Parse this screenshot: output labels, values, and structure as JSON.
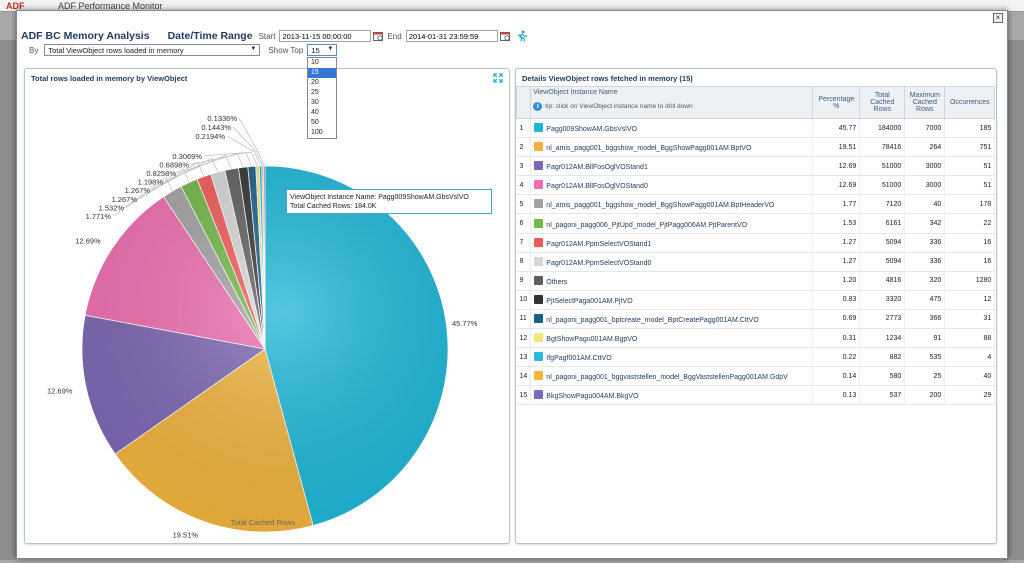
{
  "background_app": {
    "logo": "ADF",
    "title": "ADF Performance Monitor"
  },
  "header": {
    "app_title": "ADF BC Memory Analysis",
    "range_title": "Date/Time Range",
    "start_label": "Start",
    "start_value": "2013-11-15 00:00:00",
    "end_label": "End",
    "end_value": "2014-01-31 23:59:59",
    "by_label": "By",
    "by_value": "Total ViewObject rows loaded in memory",
    "show_top_label": "Show Top",
    "show_top_value": "15",
    "show_top_options": [
      "10",
      "15",
      "20",
      "25",
      "30",
      "40",
      "50",
      "100"
    ]
  },
  "left_panel": {
    "title": "Total rows loaded in memory by ViewObject",
    "tooltip_line1": "ViewObject Instance Name: Pagg009ShowAM.GbsVslVO",
    "tooltip_line2": "Total Cached Rows: 184.0K"
  },
  "chart_data": {
    "type": "pie",
    "title": "Total rows loaded in memory by ViewObject",
    "xlabel": "Total Cached Rows",
    "slice_labels": [
      "45.77%",
      "19.51%",
      "12.69%",
      "12.69%",
      "1.771%",
      "1.532%",
      "1.267%",
      "1.267%",
      "1.198%",
      "0.8258%",
      "0.6898%",
      "0.3069%",
      "0.2194%",
      "0.1443%",
      "0.1336%"
    ],
    "categories": [
      "Pagg009ShowAM.GbsVslVO",
      "nl_amis_pagg001_bggshow_model_BggShowPagg001AM.BptVO",
      "Pagr012AM.BllFosOglVOStand1",
      "Pagr012AM.BllFosOglVOStand0",
      "nl_amis_pagg001_bggshow_model_BggShowPagg001AM.BptHeaderVO",
      "nl_pagoni_pagg006_PjtUpd_model_PjtPagg006AM.PjtParentVO",
      "Pagr012AM.PpmSelectVOStand1",
      "Pagr012AM.PpmSelectVOStand0",
      "Others",
      "PjtSelectPaga001AM.PjtVO",
      "nl_pagoni_pagg001_bptcreate_model_BptCreatePagg001AM.CttVO",
      "BgtShowPagu001AM.BgpVO",
      "IfgPagf001AM.CttVO",
      "nl_pagoni_pagg001_bggvaststellen_model_BggVaststellenPagg001AM.GdpV",
      "BkgShowPagu004AM.BkgVO"
    ],
    "values": [
      45.77,
      19.51,
      12.69,
      12.69,
      1.771,
      1.532,
      1.267,
      1.267,
      1.198,
      0.8258,
      0.6898,
      0.3069,
      0.2194,
      0.1443,
      0.1336
    ],
    "colors": [
      "#1cb6d6",
      "#f0b23c",
      "#7c66b2",
      "#ee6fb0",
      "#a3a3a3",
      "#72b84a",
      "#f25a5a",
      "#d6d6d6",
      "#5f5f5f",
      "#333333",
      "#1a5f8c",
      "#f0e680",
      "#2bb8e0",
      "#f4b63c",
      "#7a6ab8"
    ]
  },
  "right_panel": {
    "title": "Details ViewObject rows fetched in memory (15)",
    "columns": {
      "name": "ViewObject Instance Name",
      "tip": "tip: click on ViewObject instance name to drill down",
      "percentage": "Percentage %",
      "total_cached": "Total Cached Rows",
      "max_cached": "Maximum Cached Rows",
      "occurrences": "Occurrences"
    },
    "rows": [
      {
        "idx": "1",
        "name": "Pagg009ShowAM.GbsVslVO",
        "color": "#1cb6d6",
        "pct": "45.77",
        "total": "184000",
        "max": "7000",
        "occ": "185"
      },
      {
        "idx": "2",
        "name": "nl_amis_pagg001_bggshow_model_BggShowPagg001AM.BptVO",
        "color": "#f0b23c",
        "pct": "19.51",
        "total": "78416",
        "max": "264",
        "occ": "751"
      },
      {
        "idx": "3",
        "name": "Pagr012AM.BllFosOglVOStand1",
        "color": "#7c66b2",
        "pct": "12.69",
        "total": "51000",
        "max": "3000",
        "occ": "51"
      },
      {
        "idx": "4",
        "name": "Pagr012AM.BllFosOglVOStand0",
        "color": "#ee6fb0",
        "pct": "12.69",
        "total": "51000",
        "max": "3000",
        "occ": "51"
      },
      {
        "idx": "5",
        "name": "nl_amis_pagg001_bggshow_model_BggShowPagg001AM.BptHeaderVO",
        "color": "#a3a3a3",
        "pct": "1.77",
        "total": "7120",
        "max": "40",
        "occ": "178"
      },
      {
        "idx": "6",
        "name": "nl_pagoni_pagg006_PjtUpd_model_PjtPagg006AM.PjtParentVO",
        "color": "#72b84a",
        "pct": "1.53",
        "total": "6161",
        "max": "342",
        "occ": "22"
      },
      {
        "idx": "7",
        "name": "Pagr012AM.PpmSelectVOStand1",
        "color": "#f25a5a",
        "pct": "1.27",
        "total": "5094",
        "max": "336",
        "occ": "16"
      },
      {
        "idx": "8",
        "name": "Pagr012AM.PpmSelectVOStand0",
        "color": "#d6d6d6",
        "pct": "1.27",
        "total": "5094",
        "max": "336",
        "occ": "16"
      },
      {
        "idx": "9",
        "name": "Others",
        "color": "#5f5f5f",
        "pct": "1.20",
        "total": "4816",
        "max": "320",
        "occ": "1280"
      },
      {
        "idx": "10",
        "name": "PjtSelectPaga001AM.PjtVO",
        "color": "#333333",
        "pct": "0.83",
        "total": "3320",
        "max": "475",
        "occ": "12"
      },
      {
        "idx": "11",
        "name": "nl_pagoni_pagg001_bptcreate_model_BptCreatePagg001AM.CttVO",
        "color": "#1a5f8c",
        "pct": "0.69",
        "total": "2773",
        "max": "366",
        "occ": "31"
      },
      {
        "idx": "12",
        "name": "BgtShowPagu001AM.BgpVO",
        "color": "#f0e680",
        "pct": "0.31",
        "total": "1234",
        "max": "91",
        "occ": "88"
      },
      {
        "idx": "13",
        "name": "IfgPagf001AM.CttVO",
        "color": "#2bb8e0",
        "pct": "0.22",
        "total": "882",
        "max": "535",
        "occ": "4"
      },
      {
        "idx": "14",
        "name": "nl_pagoni_pagg001_bggvaststellen_model_BggVaststellenPagg001AM.GdpV",
        "color": "#f4b63c",
        "pct": "0.14",
        "total": "580",
        "max": "25",
        "occ": "40"
      },
      {
        "idx": "15",
        "name": "BkgShowPagu004AM.BkgVO",
        "color": "#7a6ab8",
        "pct": "0.13",
        "total": "537",
        "max": "200",
        "occ": "29"
      }
    ]
  }
}
